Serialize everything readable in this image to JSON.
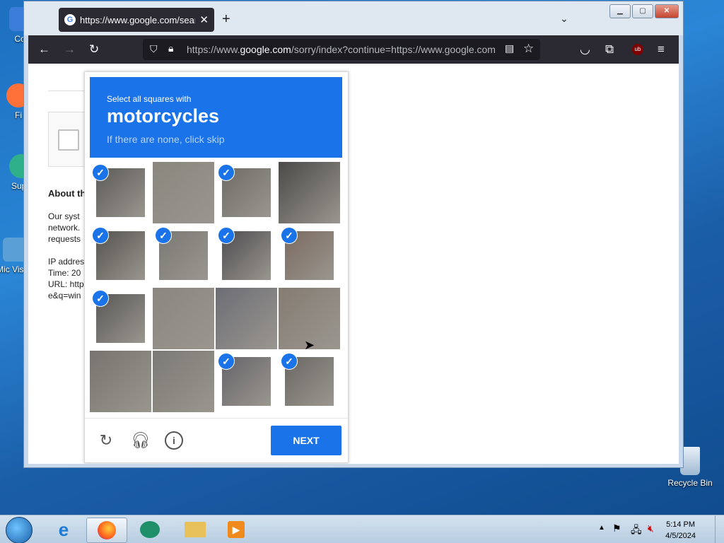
{
  "desktop": {
    "icons": [
      {
        "label": "Cor"
      },
      {
        "label": "Fi"
      },
      {
        "label": "Supe"
      },
      {
        "label": "Mic Visua"
      },
      {
        "label": "Recycle Bin"
      }
    ]
  },
  "browser": {
    "tab_title": "https://www.google.com/search",
    "tab_favicon": "G",
    "url_prefix": "https://www.",
    "url_domain": "google.com",
    "url_rest": "/sorry/index?continue=https://www.google.com"
  },
  "page_background": {
    "about_heading": "About th",
    "line1": "Our syst",
    "line2": "network.",
    "line3": "requests",
    "line4": "IP addres",
    "line5": "Time: 20",
    "line6": "URL: http",
    "line7": "e&q=win"
  },
  "captcha": {
    "instruction": "Select all squares with",
    "target": "motorcycles",
    "hint": "If there are none, click skip",
    "tiles": [
      {
        "selected": true,
        "color": "#5c5a58"
      },
      {
        "selected": false,
        "color": "#8a877f"
      },
      {
        "selected": true,
        "color": "#6f6b66"
      },
      {
        "selected": false,
        "color": "#4b4a48"
      },
      {
        "selected": true,
        "color": "#55534f"
      },
      {
        "selected": true,
        "color": "#7b7974"
      },
      {
        "selected": true,
        "color": "#4e4d50"
      },
      {
        "selected": true,
        "color": "#7a6a60"
      },
      {
        "selected": true,
        "color": "#595857"
      },
      {
        "selected": false,
        "color": "#8b8680"
      },
      {
        "selected": false,
        "color": "#6c6d75"
      },
      {
        "selected": false,
        "color": "#857c73"
      },
      {
        "selected": false,
        "color": "#77746f"
      },
      {
        "selected": false,
        "color": "#7c7a75"
      },
      {
        "selected": true,
        "color": "#66646a"
      },
      {
        "selected": true,
        "color": "#6b6864"
      }
    ],
    "next_label": "NEXT"
  },
  "taskbar": {
    "clock_time": "5:14 PM",
    "clock_date": "4/5/2024"
  },
  "colors": {
    "accent": "#1a73e8"
  }
}
